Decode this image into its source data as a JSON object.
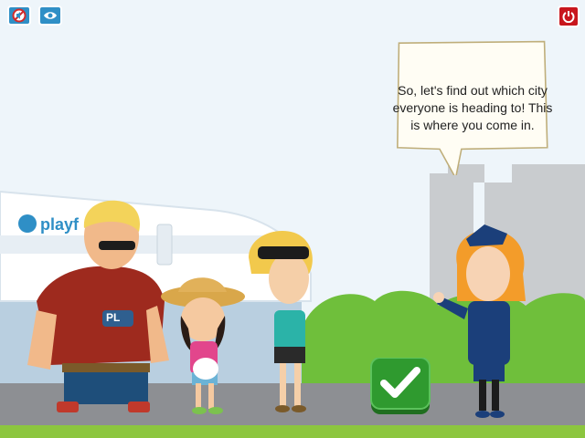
{
  "dialog": {
    "text": "So, let's find out which city everyone is heading to! This is where you come in."
  },
  "plane": {
    "brand": "playf"
  },
  "characters": {
    "man_shirt_logo": "PL"
  },
  "hud": {
    "sound_icon": "sound-muted-icon",
    "view_icon": "eye-icon",
    "quit_icon": "power-icon"
  },
  "confirm": {
    "icon": "checkmark-icon"
  },
  "colors": {
    "sky": "#e8f1f7",
    "grass": "#8cc63f",
    "runway": "#8d8f93",
    "hud_blue": "#2f8fc6",
    "quit_red": "#c8161d",
    "confirm_green": "#2f9a2f"
  }
}
